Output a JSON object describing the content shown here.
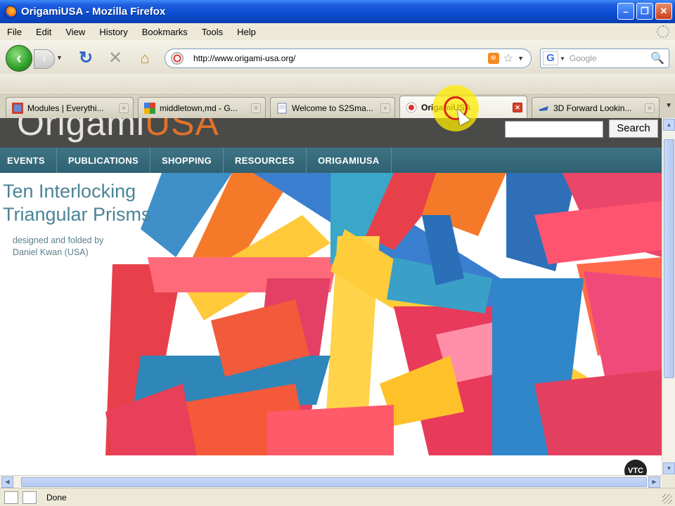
{
  "window": {
    "title": "OrigamiUSA - Mozilla Firefox"
  },
  "menu": [
    "File",
    "Edit",
    "View",
    "History",
    "Bookmarks",
    "Tools",
    "Help"
  ],
  "nav": {
    "url": "http://www.origami-usa.org/",
    "search_placeholder": "Google"
  },
  "tabs": [
    {
      "label": "Modules | Everythi...",
      "icon": "modules-favicon"
    },
    {
      "label": "middletown,md - G...",
      "icon": "google-maps-favicon"
    },
    {
      "label": "Welcome to S2Sma...",
      "icon": "page-favicon"
    },
    {
      "label": "OrigamiUSA",
      "icon": "origamiusa-favicon",
      "active": true
    },
    {
      "label": "3D Forward Lookin...",
      "icon": "3d-favicon"
    }
  ],
  "site": {
    "logo_pre": "Origami",
    "logo_post": "USA",
    "search_button": "Search",
    "nav": [
      "EVENTS",
      "PUBLICATIONS",
      "SHOPPING",
      "RESOURCES",
      "ORIGAMIUSA"
    ],
    "hero_title_line1": "Ten Interlocking",
    "hero_title_line2": "Triangular Prisms",
    "hero_credit_line1": "designed and folded by",
    "hero_credit_line2": "Daniel Kwan (USA)"
  },
  "badge": "VTC",
  "status": "Done",
  "colors": {
    "titlebar": "#0a4ccf",
    "nav_bar": "#2f6272",
    "logo_accent": "#e0722a",
    "hero_text": "#4b8495"
  }
}
